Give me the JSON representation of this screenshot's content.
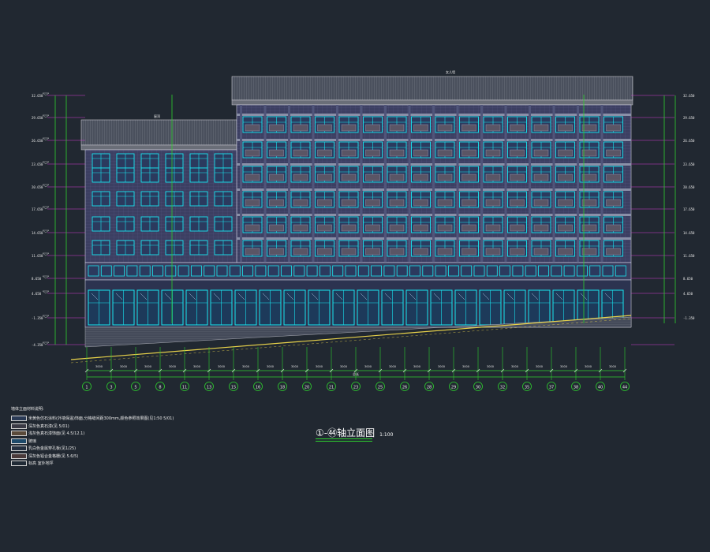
{
  "drawing": {
    "title": "①-㊹轴立面图",
    "scale": "1:100",
    "top_roof_label": "女儿墙",
    "left_roof_label": "屋顶",
    "axis_total_label": "总长"
  },
  "axis_labels": [
    "1",
    "3",
    "5",
    "8",
    "11",
    "13",
    "15",
    "16",
    "18",
    "20",
    "21",
    "23",
    "25",
    "26",
    "28",
    "29",
    "30",
    "32",
    "35",
    "37",
    "38",
    "40",
    "44"
  ],
  "dim_segments": [
    "3000",
    "3000",
    "3000",
    "3000",
    "3000",
    "3000",
    "3000",
    "3000",
    "3000",
    "3000",
    "3000",
    "3000",
    "3000",
    "3000",
    "3000",
    "3000",
    "3000",
    "3000",
    "3000",
    "3000",
    "3000",
    "3000"
  ],
  "elevations_left": [
    "32.650",
    "29.650",
    "26.650",
    "23.650",
    "20.650",
    "17.650",
    "14.650",
    "11.650",
    "8.650",
    "4.650",
    "-1.350",
    "-4.350"
  ],
  "elevations_right": [
    "32.650",
    "29.650",
    "26.650",
    "23.650",
    "20.650",
    "17.650",
    "14.650",
    "11.650",
    "8.650",
    "4.650",
    "-1.350"
  ],
  "legend": {
    "title": "墙体立面材料说明:",
    "items": [
      {
        "swatch": "#2a3a55",
        "text": "米黄色仿石涂料(外墙保温)饰面,分格缝间距300mm,颜色参照效果图(见1:50 5/01)"
      },
      {
        "swatch": "#3a3a45",
        "text": "深灰色真石漆(见 5/01)"
      },
      {
        "swatch": "#5a4a3a",
        "text": "浅灰色真石漆饰面(见 4.5/12.1)"
      },
      {
        "swatch": "#1e4a6a",
        "text": "玻璃"
      },
      {
        "swatch": "#253040",
        "text": "乳白色金属穿孔板(见1/25)"
      },
      {
        "swatch": "#4a3a3a",
        "text": "深灰色铝合金格栅(见 5.6/5)"
      },
      {
        "swatch": "#202a35",
        "text": "标高 室外地坪"
      }
    ]
  }
}
